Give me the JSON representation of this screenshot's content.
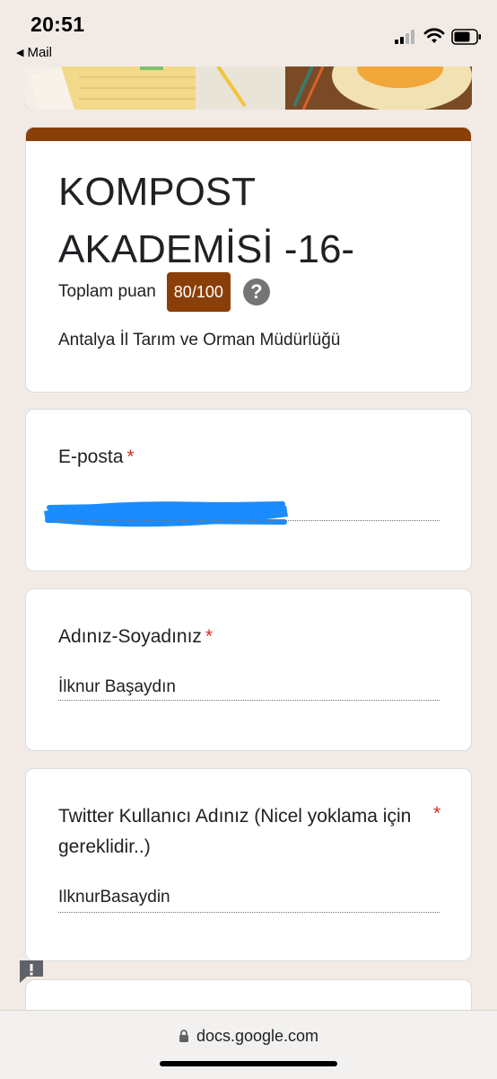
{
  "status_bar": {
    "time": "20:51",
    "back_app": "Mail"
  },
  "form": {
    "title": "KOMPOST AKADEMİSİ -16-",
    "score_label": "Toplam puan",
    "score_value": "80/100",
    "help_icon": "?",
    "description": "Antalya İl Tarım ve Orman Müdürlüğü"
  },
  "questions": [
    {
      "label": "E-posta",
      "required_mark": "*",
      "answer": ""
    },
    {
      "label": "Adınız-Soyadınız",
      "required_mark": "*",
      "answer": "İlknur Başaydın"
    },
    {
      "label": "Twitter Kullanıcı Adınız (Nicel yoklama için gereklidir..)",
      "required_mark": "*",
      "answer": "IlknurBasaydin"
    }
  ],
  "browser": {
    "url": "docs.google.com"
  },
  "colors": {
    "theme": "#8a3f08",
    "background": "#f2ebe5",
    "required": "#d93025",
    "redaction": "#1a8cff"
  },
  "icons": [
    "signal-icon",
    "wifi-icon",
    "battery-icon",
    "help-icon",
    "feedback-icon",
    "lock-icon"
  ]
}
